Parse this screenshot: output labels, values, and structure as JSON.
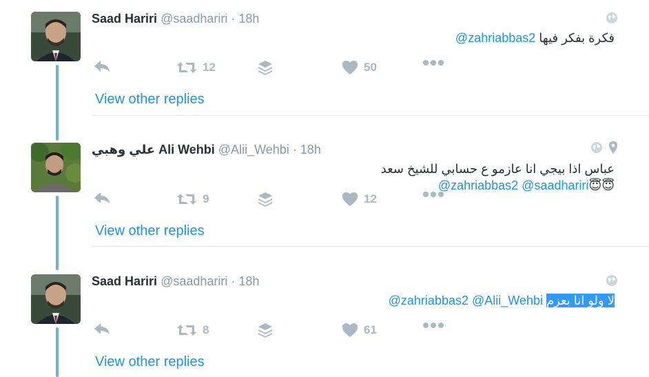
{
  "tweets": [
    {
      "name": "Saad Hariri",
      "handle": "@saadhariri",
      "dot": "·",
      "time": "18h",
      "avatar_icon": "avatar-photo-saad-hariri",
      "text_parts": {
        "mentions": "@zahriabbas2",
        "body": "فكرة بفكر فيها"
      },
      "retweets": "12",
      "likes": "50",
      "view_replies": "View other replies"
    },
    {
      "name": "علي وهبي Ali Wehbi",
      "handle": "@Alii_Wehbi",
      "dot": "·",
      "time": "18h",
      "avatar_icon": "avatar-photo-ali-wehbi",
      "text_parts": {
        "mentions": "@zahriabbas2 @saadhariri",
        "emoji": "😇😇",
        "body": "عباس اذا بيجي انا عازمو ع حسابي للشيخ سعد"
      },
      "retweets": "9",
      "likes": "12",
      "view_replies": "View other replies"
    },
    {
      "name": "Saad Hariri",
      "handle": "@saadhariri",
      "dot": "·",
      "time": "18h",
      "avatar_icon": "avatar-photo-saad-hariri",
      "text_parts": {
        "mentions": "@zahriabbas2 @Alii_Wehbi",
        "body_highlighted": "لا ولو انا بعزم"
      },
      "retweets": "8",
      "likes": "61",
      "view_replies": "View other replies"
    }
  ],
  "colors": {
    "thread_line": "#6cb4cf",
    "link": "#1b95e0",
    "muted": "#8899a6",
    "action_icon": "#aab8c2",
    "selection": "#3399ff"
  }
}
